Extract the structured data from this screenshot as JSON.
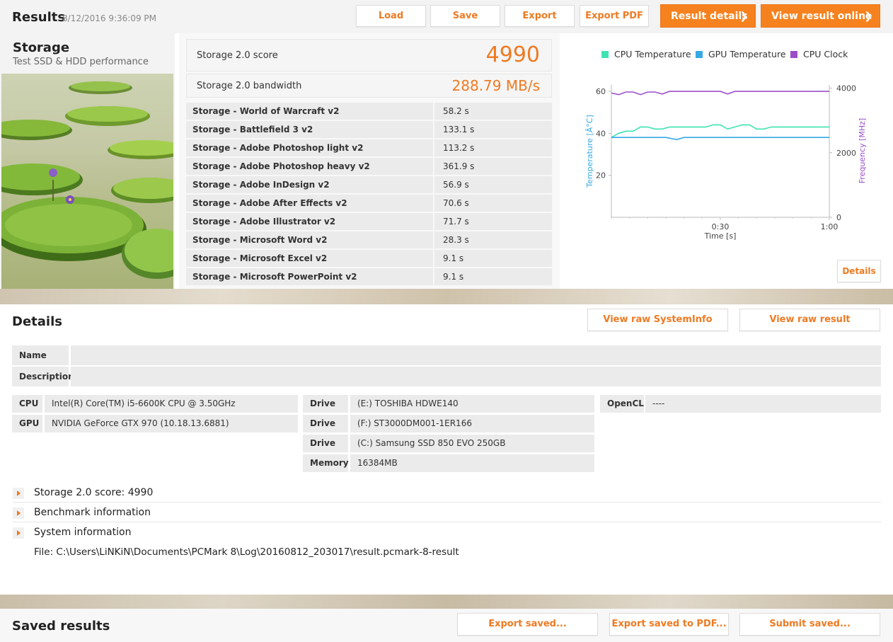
{
  "header": {
    "title": "Results",
    "timestamp": "8/12/2016 9:36:09 PM",
    "buttons": {
      "load": "Load",
      "save": "Save",
      "export": "Export",
      "export_pdf": "Export PDF"
    },
    "result_details": "Result details",
    "view_online": "View result online"
  },
  "storage": {
    "title": "Storage",
    "subtitle": "Test SSD & HDD performance",
    "score_label": "Storage 2.0 score",
    "score": "4990",
    "bandwidth_label": "Storage 2.0 bandwidth",
    "bandwidth": "288.79 MB/s",
    "rows": [
      {
        "name": "Storage - World of Warcraft v2",
        "value": "58.2 s"
      },
      {
        "name": "Storage - Battlefield 3 v2",
        "value": "133.1 s"
      },
      {
        "name": "Storage - Adobe Photoshop light v2",
        "value": "113.2 s"
      },
      {
        "name": "Storage - Adobe Photoshop heavy v2",
        "value": "361.9 s"
      },
      {
        "name": "Storage - Adobe InDesign v2",
        "value": "56.9 s"
      },
      {
        "name": "Storage - Adobe After Effects v2",
        "value": "70.6 s"
      },
      {
        "name": "Storage - Adobe Illustrator v2",
        "value": "71.7 s"
      },
      {
        "name": "Storage - Microsoft Word v2",
        "value": "28.3 s"
      },
      {
        "name": "Storage - Microsoft Excel v2",
        "value": "9.1 s"
      },
      {
        "name": "Storage - Microsoft PowerPoint v2",
        "value": "9.1 s"
      }
    ]
  },
  "chart_data": {
    "type": "line",
    "legend": [
      "CPU Temperature",
      "GPU Temperature",
      "CPU Clock"
    ],
    "legend_placement": "top",
    "colors": {
      "cpu_temp": "#3fe3b3",
      "gpu_temp": "#35a9e6",
      "cpu_clock": "#9b4ec9",
      "axis_left": "#35a9e6",
      "axis_right": "#9b4ec9"
    },
    "xlabel": "Time [s]",
    "ylabel_left": "Temperature [Â°C]",
    "ylabel_right": "Frequency [MHz]",
    "xlim": [
      0,
      60
    ],
    "ylim_left": [
      0,
      63
    ],
    "ylim_right": [
      0,
      4100
    ],
    "x_ticks": [
      {
        "v": 30,
        "label": "0:30"
      },
      {
        "v": 60,
        "label": "1:00"
      }
    ],
    "y_ticks_left": [
      20,
      40,
      60
    ],
    "y_ticks_right": [
      0,
      2000,
      4000
    ],
    "series": [
      {
        "name": "CPU Temperature",
        "axis": "left",
        "x": [
          0,
          2,
          4,
          6,
          8,
          10,
          12,
          14,
          16,
          18,
          20,
          22,
          24,
          26,
          28,
          30,
          32,
          34,
          36,
          38,
          40,
          42,
          44,
          46,
          48,
          50,
          52,
          54,
          56,
          58,
          60
        ],
        "values": [
          38,
          40,
          41,
          41,
          43,
          43,
          42,
          42,
          43,
          43,
          43,
          43,
          43,
          43,
          44,
          44,
          42,
          43,
          44,
          44,
          42,
          42,
          43,
          43,
          43,
          43,
          43,
          43,
          43,
          43,
          43
        ]
      },
      {
        "name": "GPU Temperature",
        "axis": "left",
        "x": [
          0,
          5,
          10,
          15,
          18,
          20,
          22,
          25,
          30,
          35,
          40,
          45,
          50,
          55,
          60
        ],
        "values": [
          38,
          38,
          38,
          38,
          37,
          38,
          38,
          38,
          38,
          38,
          38,
          38,
          38,
          38,
          38
        ]
      },
      {
        "name": "CPU Clock",
        "axis": "right",
        "x": [
          0,
          2,
          4,
          6,
          8,
          10,
          12,
          14,
          16,
          18,
          20,
          22,
          24,
          26,
          28,
          30,
          32,
          34,
          36,
          38,
          40,
          42,
          44,
          46,
          48,
          50,
          52,
          54,
          56,
          58,
          60
        ],
        "values": [
          3850,
          3800,
          3880,
          3880,
          3800,
          3880,
          3880,
          3820,
          3900,
          3900,
          3900,
          3900,
          3900,
          3900,
          3900,
          3900,
          3820,
          3900,
          3900,
          3900,
          3900,
          3900,
          3900,
          3900,
          3900,
          3900,
          3900,
          3900,
          3900,
          3900,
          3900
        ]
      }
    ]
  },
  "chart_details_btn": "Details",
  "details": {
    "title": "Details",
    "view_sysinfo": "View raw SystemInfo",
    "view_raw": "View raw result",
    "name_label": "Name",
    "name_value": "",
    "desc_label": "Description",
    "desc_value": "",
    "cpu_label": "CPU",
    "cpu": "Intel(R) Core(TM) i5-6600K CPU @ 3.50GHz",
    "gpu_label": "GPU",
    "gpu": "NVIDIA GeForce GTX 970 (10.18.13.6881)",
    "drive_label": "Drive",
    "drives": [
      "(E:) TOSHIBA HDWE140",
      "(F:) ST3000DM001-1ER166",
      "(C:) Samsung SSD 850 EVO 250GB"
    ],
    "memory_label": "Memory",
    "memory": "16384MB",
    "opencl_label": "OpenCL",
    "opencl": "----",
    "expand": [
      "Storage 2.0 score: 4990",
      "Benchmark information",
      "System information"
    ],
    "file": "File: C:\\Users\\LiNKiN\\Documents\\PCMark 8\\Log\\20160812_203017\\result.pcmark-8-result"
  },
  "saved": {
    "title": "Saved results",
    "export_saved": "Export saved...",
    "export_saved_pdf": "Export saved to PDF...",
    "submit_saved": "Submit saved..."
  }
}
